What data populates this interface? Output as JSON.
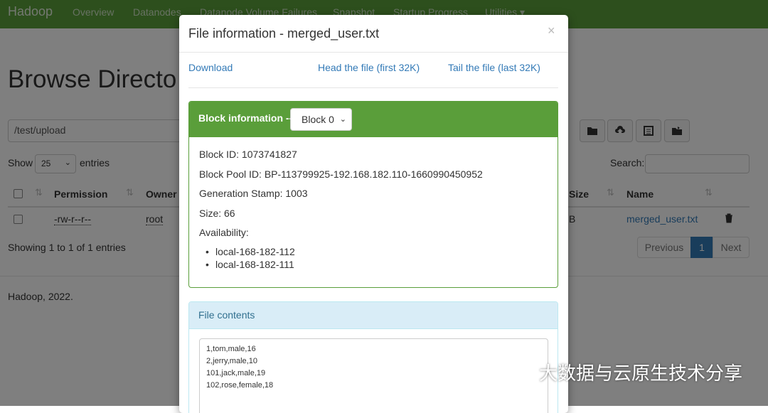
{
  "navbar": {
    "brand": "Hadoop",
    "items": [
      "Overview",
      "Datanodes",
      "Datanode Volume Failures",
      "Snapshot",
      "Startup Progress",
      "Utilities"
    ]
  },
  "page": {
    "title": "Browse Directo",
    "path": "/test/upload",
    "show_label": "Show",
    "entries_value": "25",
    "entries_label": "entries",
    "search_label": "Search:",
    "columns": [
      "Permission",
      "Owner",
      "Size",
      "Name"
    ],
    "row": {
      "permission": "-rw-r--r--",
      "owner": "root",
      "size_fragment": "B",
      "name": "merged_user.txt"
    },
    "showing": "Showing 1 to 1 of 1 entries",
    "pager": {
      "previous": "Previous",
      "current": "1",
      "next": "Next"
    },
    "footer": "Hadoop, 2022."
  },
  "modal": {
    "title": "File information - merged_user.txt",
    "close": "×",
    "links": {
      "download": "Download",
      "head": "Head the file (first 32K)",
      "tail": "Tail the file (last 32K)"
    },
    "block": {
      "label": "Block information --",
      "selected": "Block 0",
      "block_id": "Block ID: 1073741827",
      "pool_id": "Block Pool ID: BP-113799925-192.168.182.110-1660990450952",
      "gen_stamp": "Generation Stamp: 1003",
      "size": "Size: 66",
      "availability": "Availability:",
      "nodes": [
        "local-168-182-112",
        "local-168-182-111"
      ]
    },
    "contents": {
      "label": "File contents",
      "lines": [
        "1,tom,male,16",
        "2,jerry,male,10",
        "101,jack,male,19",
        "102,rose,female,18"
      ]
    }
  },
  "watermark": "大数据与云原生技术分享",
  "colors": {
    "navbar": "#5a9e3a",
    "link": "#337ab7",
    "pager_active": "#337ab7",
    "info_panel": "#d9edf7"
  }
}
